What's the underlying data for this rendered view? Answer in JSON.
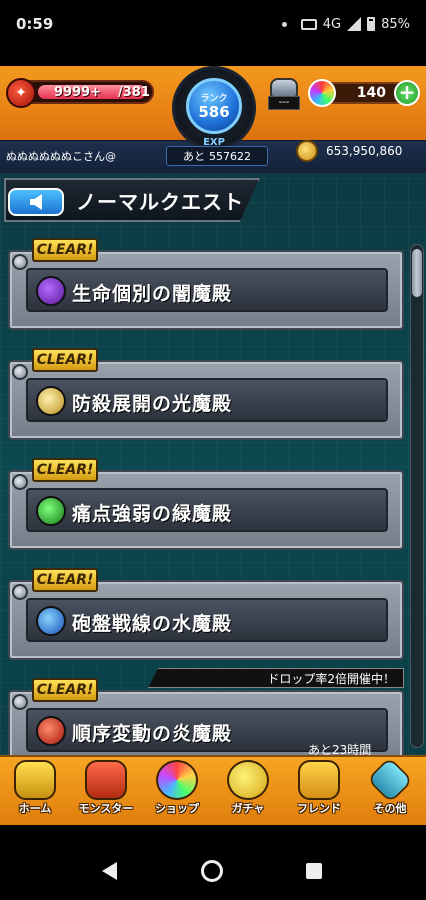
{
  "status_bar": {
    "time": "0:59",
    "network": "4G",
    "battery": "85%"
  },
  "header": {
    "stamina_current": "9999+",
    "stamina_max": "/381",
    "rank_label": "ランク",
    "rank_value": "586",
    "exp_label": "EXP",
    "exp_prefix": "あと",
    "exp_remaining": "557622",
    "user_name": "ぬぬぬぬぬぬこさん@",
    "pot_label": "---",
    "orb_count": "140",
    "orb_add": "+",
    "gold": "653,950,860"
  },
  "page": {
    "title": "ノーマルクエスト"
  },
  "quests": [
    {
      "badge": "CLEAR!",
      "name": "生命個別の闇魔殿",
      "element": "dark"
    },
    {
      "badge": "CLEAR!",
      "name": "防殺展開の光魔殿",
      "element": "light"
    },
    {
      "badge": "CLEAR!",
      "name": "痛点強弱の緑魔殿",
      "element": "wood"
    },
    {
      "badge": "CLEAR!",
      "name": "砲盤戦線の水魔殿",
      "element": "water"
    },
    {
      "badge": "CLEAR!",
      "name": "順序変動の炎魔殿",
      "element": "fire"
    }
  ],
  "event": {
    "drop_banner": "ドロップ率2倍開催中！",
    "remaining": "あと23時間"
  },
  "bottom_nav": [
    {
      "label": "ホーム",
      "icon": "home-icon"
    },
    {
      "label": "モンスター",
      "icon": "monster-icon"
    },
    {
      "label": "ショップ",
      "icon": "shop-icon"
    },
    {
      "label": "ガチャ",
      "icon": "gacha-icon"
    },
    {
      "label": "フレンド",
      "icon": "friend-icon"
    },
    {
      "label": "その他",
      "icon": "other-icon"
    }
  ],
  "colors": {
    "header_orange": "#e67d12",
    "main_teal": "#0c4850",
    "clear_gold": "#ffe25a",
    "back_blue": "#1c73d1"
  }
}
